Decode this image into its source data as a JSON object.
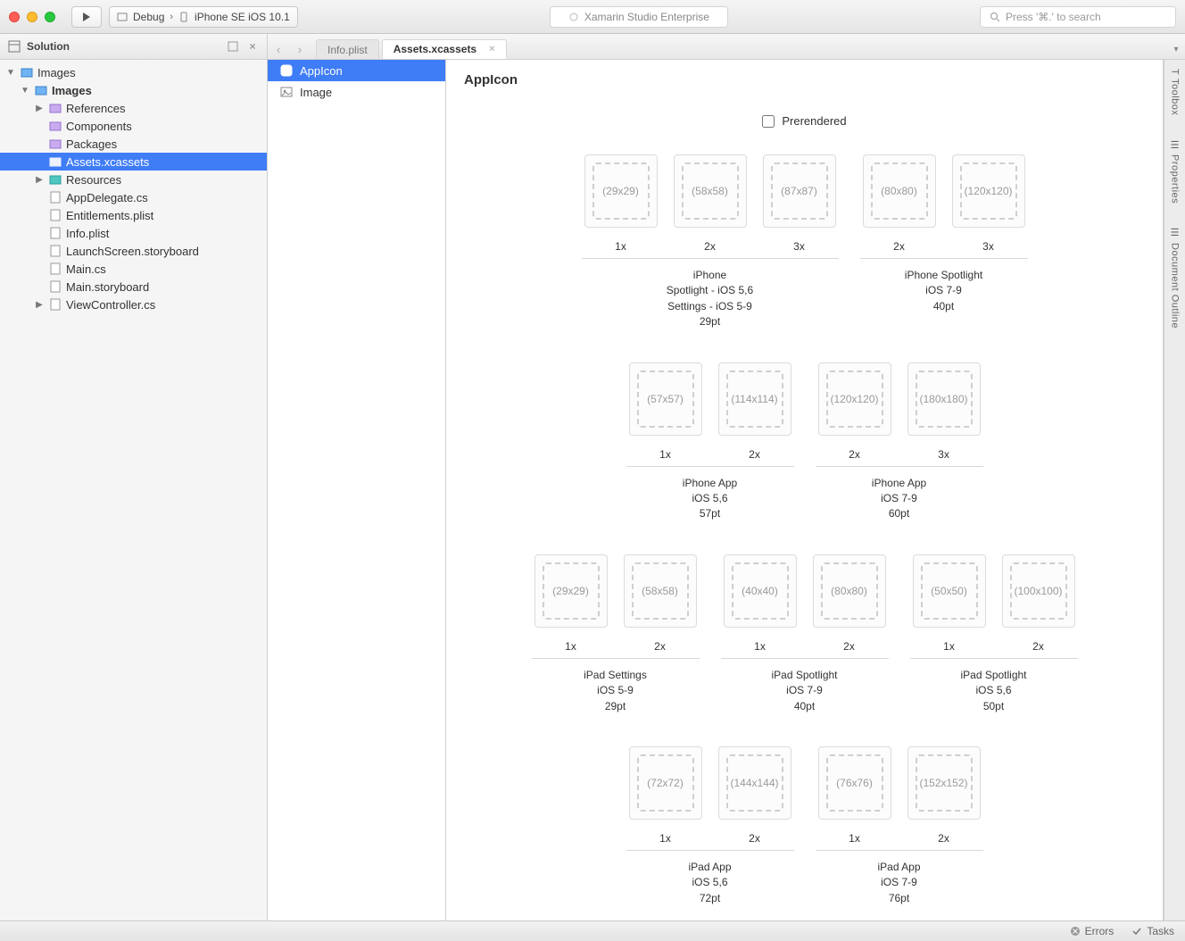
{
  "titlebar": {
    "build_config": "Debug",
    "device": "iPhone SE iOS 10.1",
    "app_title": "Xamarin Studio Enterprise",
    "search_placeholder": "Press '⌘.' to search"
  },
  "solution": {
    "header": "Solution",
    "nodes": {
      "project": "Images",
      "subproject": "Images",
      "references": "References",
      "components": "Components",
      "packages": "Packages",
      "assets": "Assets.xcassets",
      "resources": "Resources",
      "appdelegate": "AppDelegate.cs",
      "entitlements": "Entitlements.plist",
      "infoplist": "Info.plist",
      "launchscreen": "LaunchScreen.storyboard",
      "maincs": "Main.cs",
      "mainstory": "Main.storyboard",
      "viewcontroller": "ViewController.cs"
    }
  },
  "tabs": {
    "info": "Info.plist",
    "assets": "Assets.xcassets"
  },
  "asset_list": {
    "appicon": "AppIcon",
    "image": "Image"
  },
  "editor": {
    "title": "AppIcon",
    "prerendered": "Prerendered"
  },
  "icon_sets": [
    {
      "caption": "iPhone\nSpotlight - iOS 5,6\nSettings - iOS 5-9\n29pt",
      "wells": [
        {
          "size": "(29x29)",
          "scale": "1x"
        },
        {
          "size": "(58x58)",
          "scale": "2x"
        },
        {
          "size": "(87x87)",
          "scale": "3x"
        }
      ]
    },
    {
      "caption": "iPhone Spotlight\niOS 7-9\n40pt",
      "wells": [
        {
          "size": "(80x80)",
          "scale": "2x"
        },
        {
          "size": "(120x120)",
          "scale": "3x"
        }
      ]
    },
    {
      "caption": "iPhone App\niOS 5,6\n57pt",
      "wells": [
        {
          "size": "(57x57)",
          "scale": "1x"
        },
        {
          "size": "(114x114)",
          "scale": "2x"
        }
      ]
    },
    {
      "caption": "iPhone App\niOS 7-9\n60pt",
      "wells": [
        {
          "size": "(120x120)",
          "scale": "2x"
        },
        {
          "size": "(180x180)",
          "scale": "3x"
        }
      ]
    },
    {
      "caption": "iPad Settings\niOS 5-9\n29pt",
      "wells": [
        {
          "size": "(29x29)",
          "scale": "1x"
        },
        {
          "size": "(58x58)",
          "scale": "2x"
        }
      ]
    },
    {
      "caption": "iPad Spotlight\niOS 7-9\n40pt",
      "wells": [
        {
          "size": "(40x40)",
          "scale": "1x"
        },
        {
          "size": "(80x80)",
          "scale": "2x"
        }
      ]
    },
    {
      "caption": "iPad Spotlight\niOS 5,6\n50pt",
      "wells": [
        {
          "size": "(50x50)",
          "scale": "1x"
        },
        {
          "size": "(100x100)",
          "scale": "2x"
        }
      ]
    },
    {
      "caption": "iPad App\niOS 5,6\n72pt",
      "wells": [
        {
          "size": "(72x72)",
          "scale": "1x"
        },
        {
          "size": "(144x144)",
          "scale": "2x"
        }
      ]
    },
    {
      "caption": "iPad App\niOS 7-9\n76pt",
      "wells": [
        {
          "size": "(76x76)",
          "scale": "1x"
        },
        {
          "size": "(152x152)",
          "scale": "2x"
        }
      ]
    }
  ],
  "groups_rows": [
    [
      0,
      1
    ],
    [
      2,
      3
    ],
    [
      4,
      5,
      6
    ],
    [
      7,
      8
    ]
  ],
  "right_rail": {
    "toolbox": "Toolbox",
    "properties": "Properties",
    "doc_outline": "Document Outline"
  },
  "statusbar": {
    "errors": "Errors",
    "tasks": "Tasks"
  }
}
